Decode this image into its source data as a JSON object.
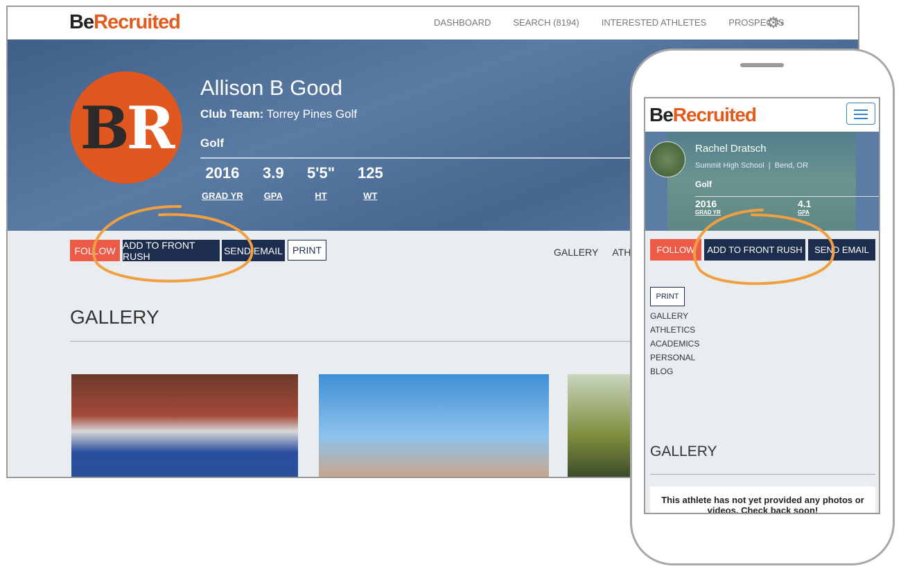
{
  "brand": {
    "logo_be": "Be",
    "logo_recruited": "Recruited",
    "accent": "#e25a1c"
  },
  "desktop": {
    "nav": [
      "DASHBOARD",
      "SEARCH (8194)",
      "INTERESTED ATHLETES",
      "PROSPECTS"
    ],
    "settings_icon": "gear-icon",
    "logo_initials": [
      "B",
      "R"
    ],
    "athlete": {
      "name": "Allison B Good",
      "club_label": "Club Team:",
      "club": "Torrey Pines Golf",
      "sport": "Golf"
    },
    "stats": [
      {
        "value": "2016",
        "label": "GRAD YR"
      },
      {
        "value": "3.9",
        "label": "GPA"
      },
      {
        "value": "5'5\"",
        "label": "HT"
      },
      {
        "value": "125",
        "label": "WT"
      }
    ],
    "buttons": {
      "follow": "FOLLOW",
      "front_rush": "ADD TO FRONT RUSH",
      "email": "SEND EMAIL",
      "print": "PRINT"
    },
    "sections": [
      "GALLERY",
      "ATHLET"
    ],
    "gallery_title": "GALLERY"
  },
  "mobile": {
    "athlete": {
      "name": "Rachel Dratsch",
      "school": "Summit High School",
      "location": "Bend, OR",
      "sport": "Golf"
    },
    "stats": [
      {
        "value": "2016",
        "label": "GRAD YR"
      },
      {
        "value": "4.1",
        "label": "GPA"
      }
    ],
    "buttons": {
      "follow": "FOLLOW",
      "front_rush": "ADD TO FRONT RUSH",
      "email": "SEND EMAIL",
      "print": "PRINT"
    },
    "sections": [
      "GALLERY",
      "ATHLETICS",
      "ACADEMICS",
      "PERSONAL",
      "BLOG"
    ],
    "gallery_title": "GALLERY",
    "empty_message": "This athlete has not yet provided any photos or videos. Check back soon!"
  }
}
